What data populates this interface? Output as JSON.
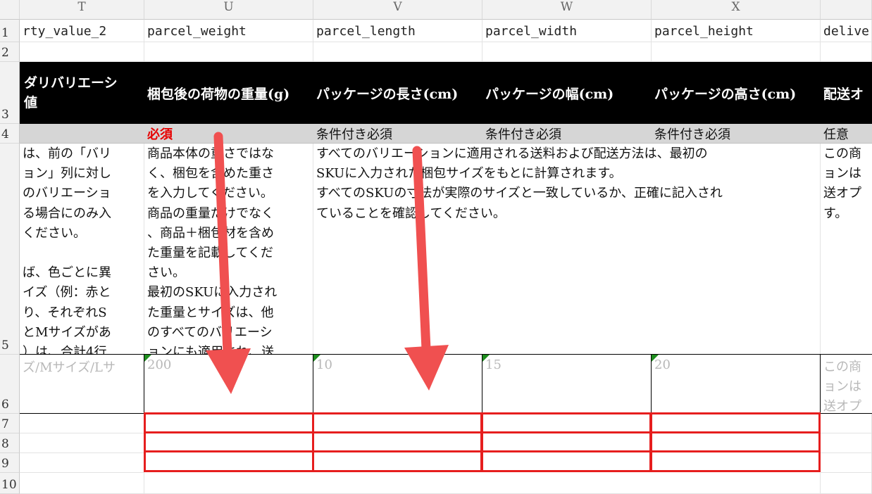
{
  "columns": {
    "T": {
      "letter": "T",
      "key": "rty_value_2",
      "label_line1": "ダリバリエーシ",
      "label_line2": "値",
      "desc": "は、前の「バリ\nョン」列に対し\nのバリエーショ\nる場合にのみ入\nください。\n\nば、色ごとに異\nイズ（例：赤と\nり、それぞれS\nとMサイズがあ\n）は、合計4行",
      "example": "ズ/Mサイズ/Lサ"
    },
    "U": {
      "letter": "U",
      "key": "parcel_weight",
      "label": "梱包後の荷物の重量(g)",
      "requirement": "必須",
      "desc": "商品本体の重さではな\nく、梱包を含めた重さ\nを入力してください。\n商品の重量だけでなく\n、商品＋梱包材を含め\nた重量を記載してくだ\nさい。\n最初のSKUに入力され\nた重量とサイズは、他\nのすべてのバリエーシ\nョンにも適用され、送",
      "example": "200"
    },
    "V": {
      "letter": "V",
      "key": "parcel_length",
      "label": "パッケージの長さ(cm)",
      "requirement": "条件付き必須",
      "desc": "すべてのバリエーションに適用される送料および配送方法は、最初の\nSKUに入力された梱包サイズをもとに計算されます。\nすべてのSKUの寸法が実際のサイズと一致しているか、正確に記入され\nていることを確認してください。",
      "example": "10"
    },
    "W": {
      "letter": "W",
      "key": "parcel_width",
      "label": "パッケージの幅(cm)",
      "requirement": "条件付き必須",
      "example": "15"
    },
    "X": {
      "letter": "X",
      "key": "parcel_height",
      "label": "パッケージの高さ(cm)",
      "requirement": "条件付き必須",
      "example": "20"
    },
    "Y": {
      "letter": "",
      "key": "delive",
      "label": "配送オ",
      "requirement": "任意",
      "desc": "この商\nョンは\n送オプ\nす。",
      "example": "この商\nョンは\n送オプ"
    }
  },
  "row_numbers": [
    "1",
    "2",
    "3",
    "4",
    "5",
    "6",
    "7",
    "8",
    "9",
    "10"
  ],
  "highlight": {
    "color": "#e61e1e",
    "rows": [
      7,
      8,
      9
    ],
    "columns": [
      "U",
      "V",
      "W",
      "X"
    ]
  },
  "annotation_arrow_color": "#f05050"
}
